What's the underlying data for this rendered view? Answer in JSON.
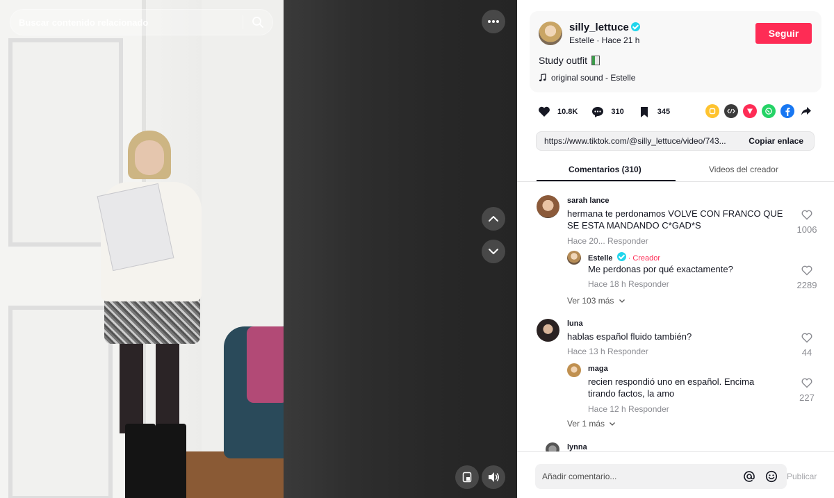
{
  "search": {
    "placeholder": "Buscar contenido relacionado"
  },
  "author": {
    "username": "silly_lettuce",
    "subtitle": "Estelle · Hace 21 h",
    "follow_label": "Seguir",
    "caption": "Study outfit",
    "sound": "original sound - Estelle"
  },
  "stats": {
    "likes": "10.8K",
    "comments": "310",
    "saves": "345"
  },
  "share": {
    "icons": [
      "repost-icon",
      "embed-icon",
      "send-icon",
      "whatsapp-icon",
      "facebook-icon",
      "share-arrow-icon"
    ],
    "colors": {
      "repost": "#fec32f",
      "embed": "#3b3b3b",
      "send": "#fe2c55",
      "whatsapp": "#25d366",
      "facebook": "#1877f2"
    }
  },
  "link": {
    "url": "https://www.tiktok.com/@silly_lettuce/video/743...",
    "copy_label": "Copiar enlace"
  },
  "tabs": {
    "comments": "Comentarios (310)",
    "videos": "Videos del creador"
  },
  "comments": [
    {
      "user": "sarah lance",
      "text": "hermana te perdonamos VOLVE CON FRANCO QUE SE ESTA MANDANDO C*GAD*S",
      "time": "Hace 20...",
      "reply_label": "Responder",
      "likes": "1006",
      "reply": {
        "user": "Estelle",
        "creator_tag": "· Creador",
        "text": "Me perdonas por qué exactamente?",
        "time": "Hace 18 h",
        "reply_label": "Responder",
        "likes": "2289"
      },
      "see_more": "Ver 103 más"
    },
    {
      "user": "luna",
      "text": "hablas español fluido también?",
      "time": "Hace 13 h",
      "reply_label": "Responder",
      "likes": "44",
      "reply": {
        "user": "maga",
        "text": "recien respondió uno en español. Encima tirando factos, la amo",
        "time": "Hace 12 h",
        "reply_label": "Responder",
        "likes": "227"
      },
      "see_more": "Ver 1 más"
    },
    {
      "user": "lynna"
    }
  ],
  "composer": {
    "placeholder": "Añadir comentario...",
    "publish_label": "Publicar"
  },
  "colors": {
    "accent": "#fe2c55",
    "verified": "#20d5ec"
  }
}
